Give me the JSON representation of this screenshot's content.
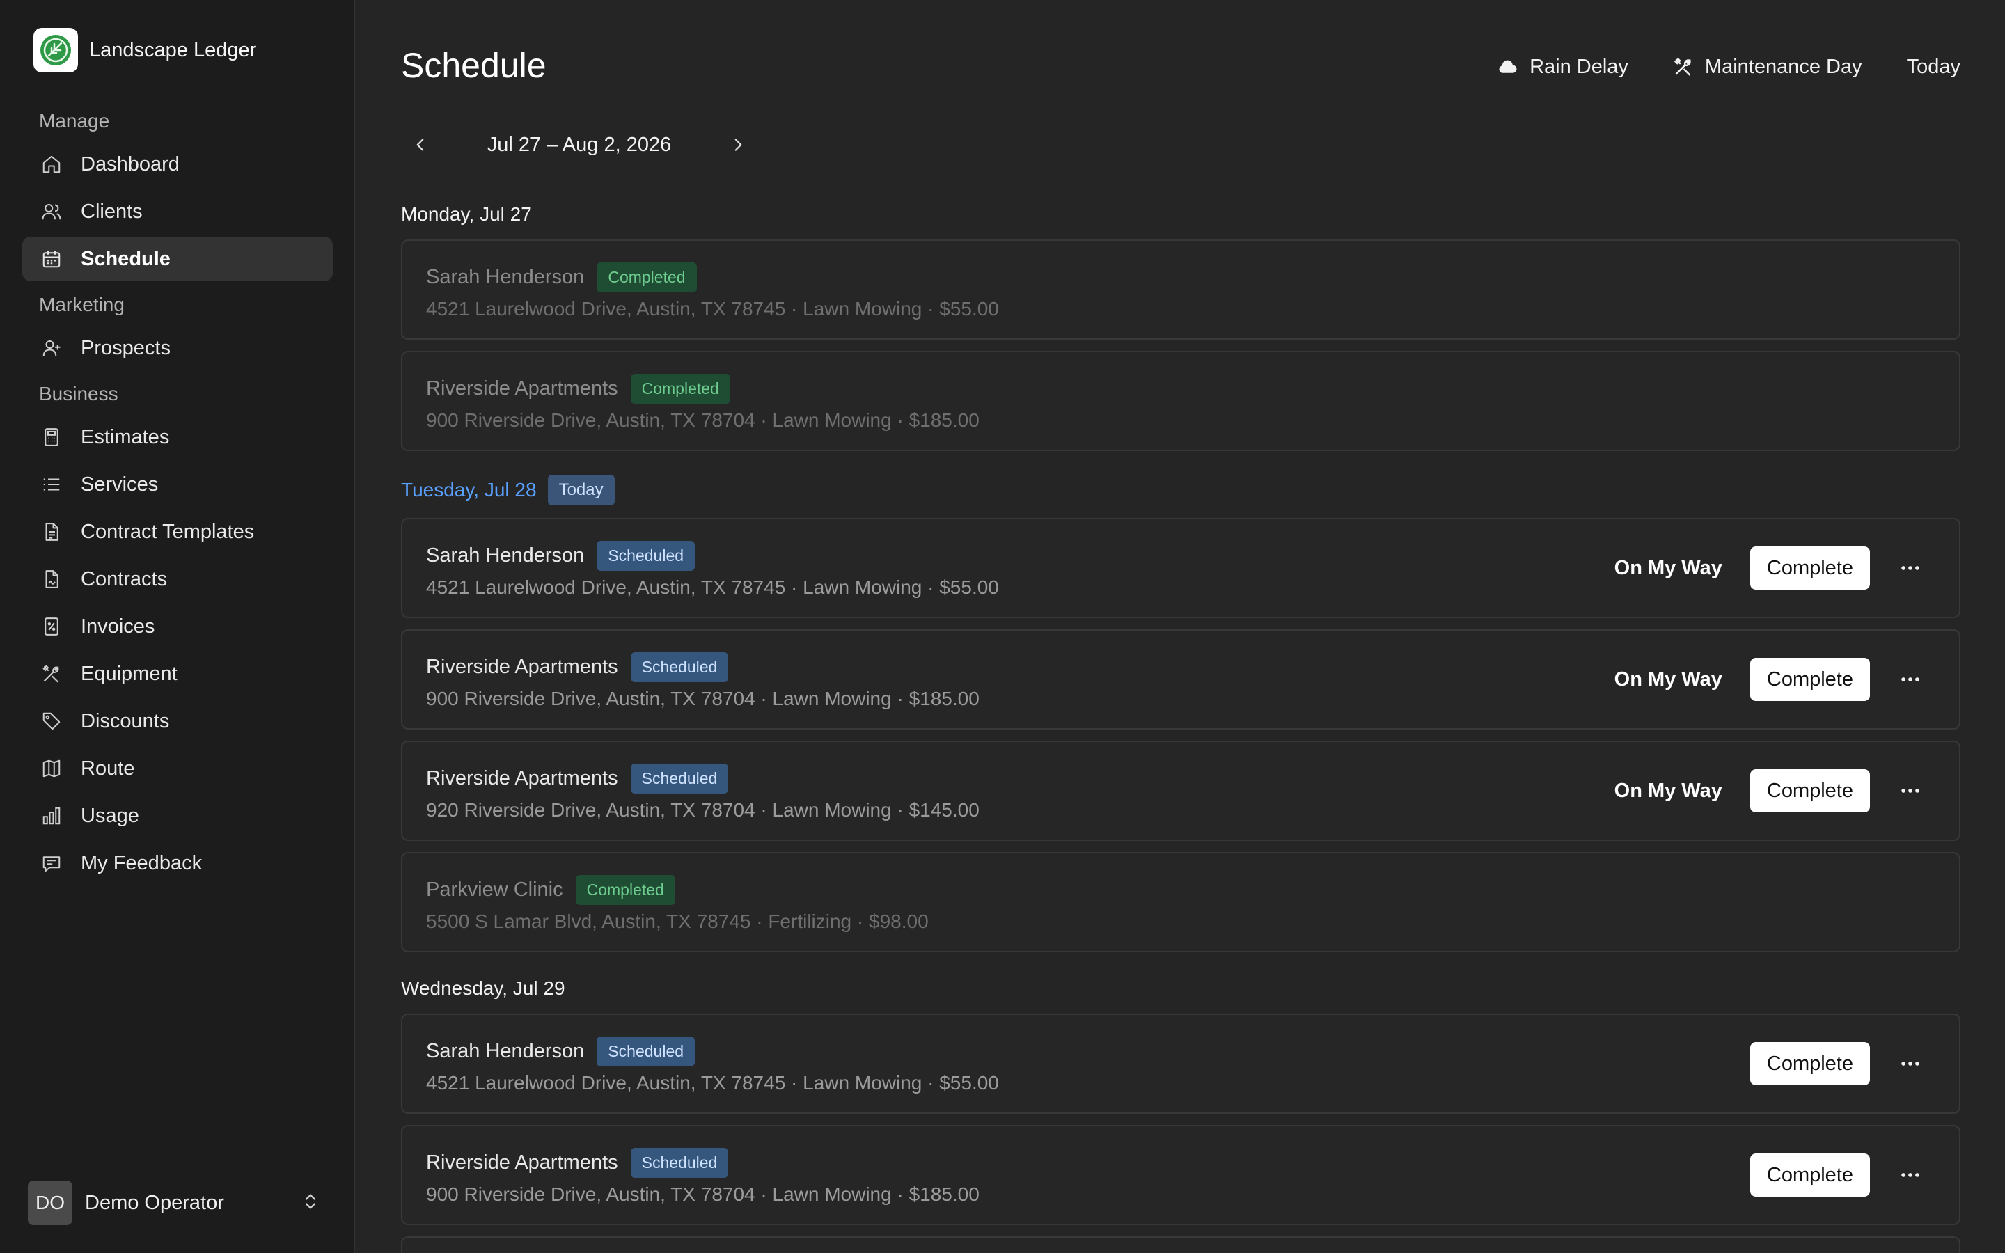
{
  "app": {
    "name": "Landscape Ledger"
  },
  "sidebar": {
    "sections": {
      "manage": "Manage",
      "marketing": "Marketing",
      "business": "Business"
    },
    "items": {
      "dashboard": "Dashboard",
      "clients": "Clients",
      "schedule": "Schedule",
      "prospects": "Prospects",
      "estimates": "Estimates",
      "services": "Services",
      "contract_templates": "Contract Templates",
      "contracts": "Contracts",
      "invoices": "Invoices",
      "equipment": "Equipment",
      "discounts": "Discounts",
      "route": "Route",
      "usage": "Usage",
      "my_feedback": "My Feedback"
    },
    "active": "Schedule",
    "user": {
      "initials": "DO",
      "name": "Demo Operator"
    }
  },
  "header": {
    "title": "Schedule",
    "actions": {
      "rain_delay": "Rain Delay",
      "maintenance_day": "Maintenance Day",
      "today": "Today"
    }
  },
  "week": {
    "range": "Jul 27 – Aug 2, 2026"
  },
  "labels": {
    "on_my_way": "On My Way",
    "complete": "Complete",
    "today_tag": "Today"
  },
  "days": [
    {
      "label": "Monday, Jul 27",
      "jobs": [
        {
          "client": "Sarah Henderson",
          "status": "Completed",
          "details": "4521 Laurelwood Drive, Austin, TX 78745 · Lawn Mowing · $55.00"
        },
        {
          "client": "Riverside Apartments",
          "status": "Completed",
          "details": "900 Riverside Drive, Austin, TX 78704 · Lawn Mowing · $185.00"
        }
      ]
    },
    {
      "label": "Tuesday, Jul 28",
      "jobs": [
        {
          "client": "Sarah Henderson",
          "status": "Scheduled",
          "details": "4521 Laurelwood Drive, Austin, TX 78745 · Lawn Mowing · $55.00"
        },
        {
          "client": "Riverside Apartments",
          "status": "Scheduled",
          "details": "900 Riverside Drive, Austin, TX 78704 · Lawn Mowing · $185.00"
        },
        {
          "client": "Riverside Apartments",
          "status": "Scheduled",
          "details": "920 Riverside Drive, Austin, TX 78704 · Lawn Mowing · $145.00"
        },
        {
          "client": "Parkview Clinic",
          "status": "Completed",
          "details": "5500 S Lamar Blvd, Austin, TX 78745 · Fertilizing · $98.00"
        }
      ]
    },
    {
      "label": "Wednesday, Jul 29",
      "jobs": [
        {
          "client": "Sarah Henderson",
          "status": "Scheduled",
          "details": "4521 Laurelwood Drive, Austin, TX 78745 · Lawn Mowing · $55.00"
        },
        {
          "client": "Riverside Apartments",
          "status": "Scheduled",
          "details": "900 Riverside Drive, Austin, TX 78704 · Lawn Mowing · $185.00"
        }
      ]
    }
  ]
}
